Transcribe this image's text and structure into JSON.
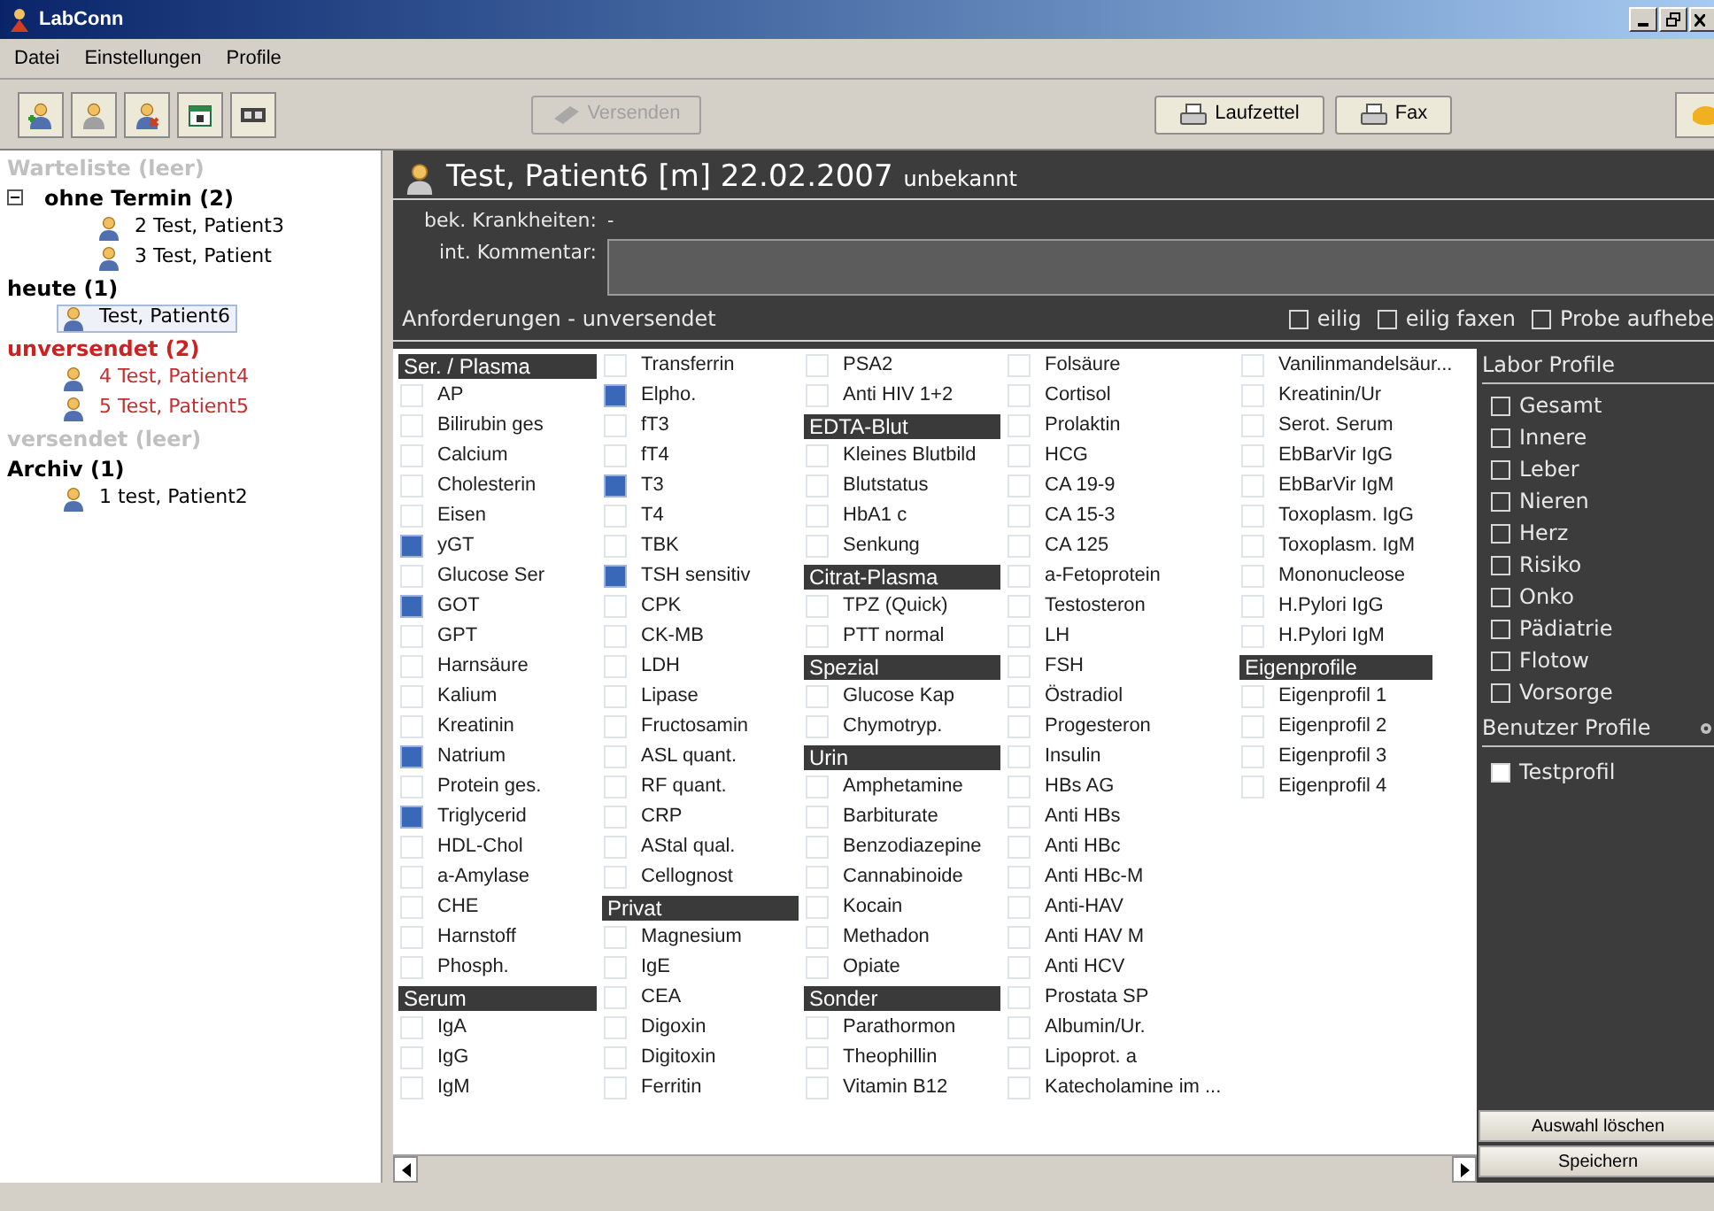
{
  "window": {
    "title": "LabConn"
  },
  "menu": [
    "Datei",
    "Einstellungen",
    "Profile"
  ],
  "toolbar": {
    "versenden": {
      "label": "Versenden",
      "disabled": true
    },
    "buttons": [
      "Laufzettel",
      "Fax"
    ]
  },
  "tree": [
    {
      "label": "Warteliste (leer)",
      "color": "#c0c0c0"
    },
    {
      "label": "ohne Termin (2)",
      "color": "#000000",
      "expanded": true,
      "children": [
        {
          "label": "2 Test, Patient3",
          "selected": false
        },
        {
          "label": "3 Test, Patient",
          "selected": false
        }
      ]
    },
    {
      "label": "heute (1)",
      "color": "#000000",
      "children": [
        {
          "label": "Test, Patient6",
          "selected": true
        }
      ]
    },
    {
      "label": "unversendet (2)",
      "color": "#cc2222",
      "children": [
        {
          "label": "4 Test, Patient4",
          "selected": false
        },
        {
          "label": "5 Test, Patient5",
          "selected": false
        }
      ]
    },
    {
      "label": "versendet (leer)",
      "color": "#c0c0c0"
    },
    {
      "label": "Archiv (1)",
      "color": "#000000",
      "children": [
        {
          "label": "1 test, Patient2",
          "selected": false
        }
      ]
    }
  ],
  "patient": {
    "name": "Test, Patient6 [m] 22.02.2007",
    "status": "unbekannt",
    "diseases_label": "bek. Krankheiten:",
    "diseases": "-",
    "comment_label": "int. Kommentar:"
  },
  "requests": {
    "title": "Anforderungen - unversendet",
    "options": [
      {
        "label": "eilig",
        "checked": false
      },
      {
        "label": "eilig faxen",
        "checked": false
      },
      {
        "label": "Probe aufhebe",
        "checked": false
      }
    ]
  },
  "columns": [
    [
      {
        "kind": "header",
        "label": "Ser. / Plasma"
      },
      {
        "kind": "item",
        "label": "AP",
        "checked": false
      },
      {
        "kind": "item",
        "label": "Bilirubin ges",
        "checked": false
      },
      {
        "kind": "item",
        "label": "Calcium",
        "checked": false
      },
      {
        "kind": "item",
        "label": "Cholesterin",
        "checked": false
      },
      {
        "kind": "item",
        "label": "Eisen",
        "checked": false
      },
      {
        "kind": "item",
        "label": "yGT",
        "checked": true
      },
      {
        "kind": "item",
        "label": "Glucose Ser",
        "checked": false
      },
      {
        "kind": "item",
        "label": "GOT",
        "checked": true
      },
      {
        "kind": "item",
        "label": "GPT",
        "checked": false
      },
      {
        "kind": "item",
        "label": "Harnsäure",
        "checked": false
      },
      {
        "kind": "item",
        "label": "Kalium",
        "checked": false
      },
      {
        "kind": "item",
        "label": "Kreatinin",
        "checked": false
      },
      {
        "kind": "item",
        "label": "Natrium",
        "checked": true
      },
      {
        "kind": "item",
        "label": "Protein ges.",
        "checked": false
      },
      {
        "kind": "item",
        "label": "Triglycerid",
        "checked": true
      },
      {
        "kind": "item",
        "label": "HDL-Chol",
        "checked": false
      },
      {
        "kind": "item",
        "label": "a-Amylase",
        "checked": false
      },
      {
        "kind": "item",
        "label": "CHE",
        "checked": false
      },
      {
        "kind": "item",
        "label": "Harnstoff",
        "checked": false
      },
      {
        "kind": "item",
        "label": "Phosph.",
        "checked": false
      },
      {
        "kind": "header",
        "label": "Serum"
      },
      {
        "kind": "item",
        "label": "IgA",
        "checked": false
      },
      {
        "kind": "item",
        "label": "IgG",
        "checked": false
      },
      {
        "kind": "item",
        "label": "IgM",
        "checked": false
      }
    ],
    [
      {
        "kind": "item",
        "label": "Transferrin",
        "checked": false
      },
      {
        "kind": "item",
        "label": "Elpho.",
        "checked": true
      },
      {
        "kind": "item",
        "label": "fT3",
        "checked": false
      },
      {
        "kind": "item",
        "label": "fT4",
        "checked": false
      },
      {
        "kind": "item",
        "label": "T3",
        "checked": true
      },
      {
        "kind": "item",
        "label": "T4",
        "checked": false
      },
      {
        "kind": "item",
        "label": "TBK",
        "checked": false
      },
      {
        "kind": "item",
        "label": "TSH sensitiv",
        "checked": true
      },
      {
        "kind": "item",
        "label": "CPK",
        "checked": false
      },
      {
        "kind": "item",
        "label": "CK-MB",
        "checked": false
      },
      {
        "kind": "item",
        "label": "LDH",
        "checked": false
      },
      {
        "kind": "item",
        "label": "Lipase",
        "checked": false
      },
      {
        "kind": "item",
        "label": "Fructosamin",
        "checked": false
      },
      {
        "kind": "item",
        "label": "ASL quant.",
        "checked": false
      },
      {
        "kind": "item",
        "label": "RF quant.",
        "checked": false
      },
      {
        "kind": "item",
        "label": "CRP",
        "checked": false
      },
      {
        "kind": "item",
        "label": "AStal qual.",
        "checked": false
      },
      {
        "kind": "item",
        "label": "Cellognost",
        "checked": false
      },
      {
        "kind": "header",
        "label": "Privat"
      },
      {
        "kind": "item",
        "label": "Magnesium",
        "checked": false
      },
      {
        "kind": "item",
        "label": "IgE",
        "checked": false
      },
      {
        "kind": "item",
        "label": "CEA",
        "checked": false
      },
      {
        "kind": "item",
        "label": "Digoxin",
        "checked": false
      },
      {
        "kind": "item",
        "label": "Digitoxin",
        "checked": false
      },
      {
        "kind": "item",
        "label": "Ferritin",
        "checked": false
      }
    ],
    [
      {
        "kind": "item",
        "label": "PSA2",
        "checked": false
      },
      {
        "kind": "item",
        "label": "Anti HIV 1+2",
        "checked": false
      },
      {
        "kind": "header",
        "label": "EDTA-Blut"
      },
      {
        "kind": "item",
        "label": "Kleines Blutbild",
        "checked": false
      },
      {
        "kind": "item",
        "label": "Blutstatus",
        "checked": false
      },
      {
        "kind": "item",
        "label": "HbA1 c",
        "checked": false
      },
      {
        "kind": "item",
        "label": "Senkung",
        "checked": false
      },
      {
        "kind": "header",
        "label": "Citrat-Plasma"
      },
      {
        "kind": "item",
        "label": "TPZ (Quick)",
        "checked": false
      },
      {
        "kind": "item",
        "label": "PTT normal",
        "checked": false
      },
      {
        "kind": "header",
        "label": "Spezial"
      },
      {
        "kind": "item",
        "label": "Glucose Kap",
        "checked": false
      },
      {
        "kind": "item",
        "label": "Chymotryp.",
        "checked": false
      },
      {
        "kind": "header",
        "label": "Urin"
      },
      {
        "kind": "item",
        "label": "Amphetamine",
        "checked": false
      },
      {
        "kind": "item",
        "label": "Barbiturate",
        "checked": false
      },
      {
        "kind": "item",
        "label": "Benzodiazepine",
        "checked": false
      },
      {
        "kind": "item",
        "label": "Cannabinoide",
        "checked": false
      },
      {
        "kind": "item",
        "label": "Kocain",
        "checked": false
      },
      {
        "kind": "item",
        "label": "Methadon",
        "checked": false
      },
      {
        "kind": "item",
        "label": "Opiate",
        "checked": false
      },
      {
        "kind": "header",
        "label": "Sonder"
      },
      {
        "kind": "item",
        "label": "Parathormon",
        "checked": false
      },
      {
        "kind": "item",
        "label": "Theophillin",
        "checked": false
      },
      {
        "kind": "item",
        "label": "Vitamin B12",
        "checked": false
      }
    ],
    [
      {
        "kind": "item",
        "label": "Folsäure",
        "checked": false
      },
      {
        "kind": "item",
        "label": "Cortisol",
        "checked": false
      },
      {
        "kind": "item",
        "label": "Prolaktin",
        "checked": false
      },
      {
        "kind": "item",
        "label": "HCG",
        "checked": false
      },
      {
        "kind": "item",
        "label": "CA 19-9",
        "checked": false
      },
      {
        "kind": "item",
        "label": "CA 15-3",
        "checked": false
      },
      {
        "kind": "item",
        "label": "CA 125",
        "checked": false
      },
      {
        "kind": "item",
        "label": "a-Fetoprotein",
        "checked": false
      },
      {
        "kind": "item",
        "label": "Testosteron",
        "checked": false
      },
      {
        "kind": "item",
        "label": "LH",
        "checked": false
      },
      {
        "kind": "item",
        "label": "FSH",
        "checked": false
      },
      {
        "kind": "item",
        "label": "Östradiol",
        "checked": false
      },
      {
        "kind": "item",
        "label": "Progesteron",
        "checked": false
      },
      {
        "kind": "item",
        "label": "Insulin",
        "checked": false
      },
      {
        "kind": "item",
        "label": "HBs AG",
        "checked": false
      },
      {
        "kind": "item",
        "label": "Anti HBs",
        "checked": false
      },
      {
        "kind": "item",
        "label": "Anti HBc",
        "checked": false
      },
      {
        "kind": "item",
        "label": "Anti HBc-M",
        "checked": false
      },
      {
        "kind": "item",
        "label": "Anti-HAV",
        "checked": false
      },
      {
        "kind": "item",
        "label": "Anti HAV M",
        "checked": false
      },
      {
        "kind": "item",
        "label": "Anti HCV",
        "checked": false
      },
      {
        "kind": "item",
        "label": "Prostata SP",
        "checked": false
      },
      {
        "kind": "item",
        "label": "Albumin/Ur.",
        "checked": false
      },
      {
        "kind": "item",
        "label": "Lipoprot. a",
        "checked": false
      },
      {
        "kind": "item",
        "label": "Katecholamine im ...",
        "checked": false
      }
    ],
    [
      {
        "kind": "item",
        "label": "Vanilinmandelsäur...",
        "checked": false
      },
      {
        "kind": "item",
        "label": "Kreatinin/Ur",
        "checked": false
      },
      {
        "kind": "item",
        "label": "Serot. Serum",
        "checked": false
      },
      {
        "kind": "item",
        "label": "EbBarVir IgG",
        "checked": false
      },
      {
        "kind": "item",
        "label": "EbBarVir IgM",
        "checked": false
      },
      {
        "kind": "item",
        "label": "Toxoplasm. IgG",
        "checked": false
      },
      {
        "kind": "item",
        "label": "Toxoplasm. IgM",
        "checked": false
      },
      {
        "kind": "item",
        "label": "Mononucleose",
        "checked": false
      },
      {
        "kind": "item",
        "label": "H.Pylori IgG",
        "checked": false
      },
      {
        "kind": "item",
        "label": "H.Pylori IgM",
        "checked": false
      },
      {
        "kind": "header",
        "label": "Eigenprofile"
      },
      {
        "kind": "item",
        "label": "Eigenprofil 1",
        "checked": false
      },
      {
        "kind": "item",
        "label": "Eigenprofil 2",
        "checked": false
      },
      {
        "kind": "item",
        "label": "Eigenprofil 3",
        "checked": false
      },
      {
        "kind": "item",
        "label": "Eigenprofil 4",
        "checked": false
      }
    ]
  ],
  "lab_profiles": {
    "title": "Labor Profile",
    "items": [
      {
        "label": "Gesamt",
        "checked": false
      },
      {
        "label": "Innere",
        "checked": false
      },
      {
        "label": "Leber",
        "checked": false
      },
      {
        "label": "Nieren",
        "checked": false
      },
      {
        "label": "Herz",
        "checked": false
      },
      {
        "label": "Risiko",
        "checked": false
      },
      {
        "label": "Onko",
        "checked": false
      },
      {
        "label": "Pädiatrie",
        "checked": false
      },
      {
        "label": "Flotow",
        "checked": false
      },
      {
        "label": "Vorsorge",
        "checked": false
      }
    ]
  },
  "user_profiles": {
    "title": "Benutzer Profile",
    "items": [
      {
        "label": "Testprofil",
        "checked": false
      }
    ]
  },
  "actions": [
    "Auswahl löschen",
    "Speichern"
  ]
}
